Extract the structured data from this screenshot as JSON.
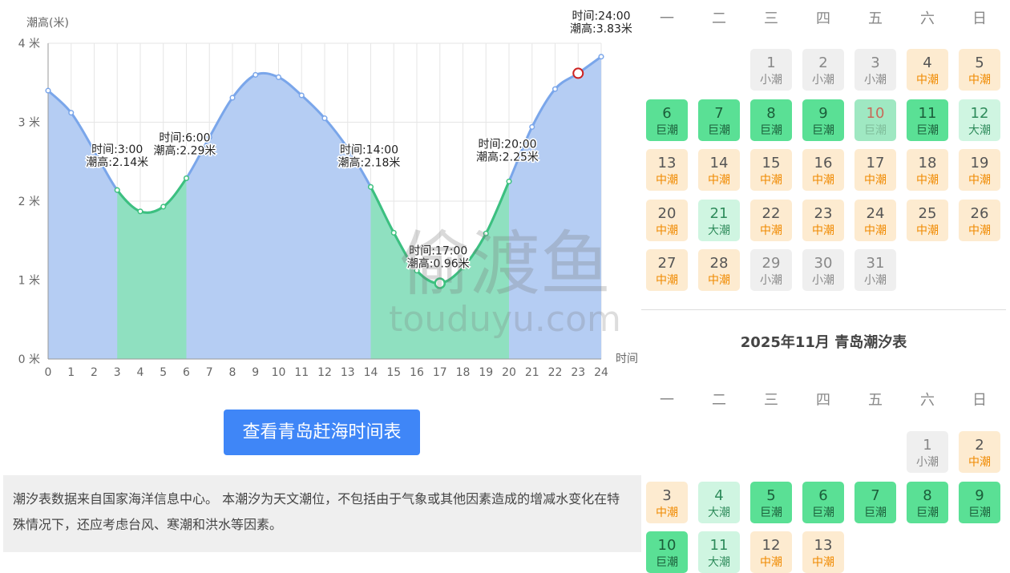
{
  "chart_data": {
    "type": "area",
    "ylabel": "潮高(米)",
    "xlabel": "时间",
    "y_ticks": [
      "0 米",
      "1 米",
      "2 米",
      "3 米",
      "4 米"
    ],
    "ylim": [
      0,
      4
    ],
    "xlim": [
      0,
      24
    ],
    "x": [
      0,
      1,
      2,
      3,
      4,
      5,
      6,
      7,
      8,
      9,
      10,
      11,
      12,
      13,
      14,
      15,
      16,
      17,
      18,
      19,
      20,
      21,
      22,
      23,
      24
    ],
    "values": [
      3.4,
      3.12,
      2.64,
      2.14,
      1.87,
      1.93,
      2.29,
      2.81,
      3.31,
      3.6,
      3.57,
      3.34,
      3.05,
      2.67,
      2.18,
      1.6,
      1.12,
      0.96,
      1.16,
      1.59,
      2.25,
      2.94,
      3.42,
      3.62,
      3.83
    ],
    "highlight_ranges": [
      [
        3,
        6
      ],
      [
        14,
        20
      ]
    ],
    "colors": {
      "area": "#b5cdf3",
      "line": "#7aa6ea",
      "highlight_area": "#8fe0c0",
      "highlight_line": "#3cc17e",
      "marker_red": "#cc2222"
    },
    "annotations": [
      {
        "x": 3,
        "line1": "时间:3:00",
        "line2": "潮高:2.14米"
      },
      {
        "x": 6,
        "line1": "时间:6:00",
        "line2": "潮高:2.29米"
      },
      {
        "x": 14,
        "line1": "时间:14:00",
        "line2": "潮高:2.18米"
      },
      {
        "x": 17,
        "line1": "时间:17:00",
        "line2": "潮高:0.96米"
      },
      {
        "x": 20,
        "line1": "时间:20:00",
        "line2": "潮高:2.25米"
      },
      {
        "x": 24,
        "line1": "时间:24:00",
        "line2": "潮高:3.83米"
      }
    ],
    "current_marker_x": 23,
    "low_marker_x": 17,
    "watermark": {
      "main": "偷渡鱼",
      "sub": "touduyu.com"
    }
  },
  "button_label": "查看青岛赶海时间表",
  "notice_text": "潮汐表数据来自国家海洋信息中心。 本潮汐为天文潮位，不包括由于气象或其他因素造成的增减水变化在特殊情况下，还应考虑台风、寒潮和洪水等因素。",
  "weekdays": [
    "一",
    "二",
    "三",
    "四",
    "五",
    "六",
    "日"
  ],
  "calendar_oct": {
    "start_col": 2,
    "days": [
      {
        "d": "1",
        "t": "小潮"
      },
      {
        "d": "2",
        "t": "小潮"
      },
      {
        "d": "3",
        "t": "小潮"
      },
      {
        "d": "4",
        "t": "中潮"
      },
      {
        "d": "5",
        "t": "中潮"
      },
      {
        "d": "6",
        "t": "巨潮"
      },
      {
        "d": "7",
        "t": "巨潮"
      },
      {
        "d": "8",
        "t": "巨潮"
      },
      {
        "d": "9",
        "t": "巨潮"
      },
      {
        "d": "10",
        "t": "巨潮",
        "today": true
      },
      {
        "d": "11",
        "t": "巨潮"
      },
      {
        "d": "12",
        "t": "大潮"
      },
      {
        "d": "13",
        "t": "中潮"
      },
      {
        "d": "14",
        "t": "中潮"
      },
      {
        "d": "15",
        "t": "中潮"
      },
      {
        "d": "16",
        "t": "中潮"
      },
      {
        "d": "17",
        "t": "中潮"
      },
      {
        "d": "18",
        "t": "中潮"
      },
      {
        "d": "19",
        "t": "中潮"
      },
      {
        "d": "20",
        "t": "中潮"
      },
      {
        "d": "21",
        "t": "大潮"
      },
      {
        "d": "22",
        "t": "中潮"
      },
      {
        "d": "23",
        "t": "中潮"
      },
      {
        "d": "24",
        "t": "中潮"
      },
      {
        "d": "25",
        "t": "中潮"
      },
      {
        "d": "26",
        "t": "中潮"
      },
      {
        "d": "27",
        "t": "中潮"
      },
      {
        "d": "28",
        "t": "中潮"
      },
      {
        "d": "29",
        "t": "小潮"
      },
      {
        "d": "30",
        "t": "小潮"
      },
      {
        "d": "31",
        "t": "小潮"
      }
    ]
  },
  "calendar_nov": {
    "title": "2025年11月 青岛潮汐表",
    "start_col": 5,
    "days": [
      {
        "d": "1",
        "t": "小潮"
      },
      {
        "d": "2",
        "t": "中潮"
      },
      {
        "d": "3",
        "t": "中潮"
      },
      {
        "d": "4",
        "t": "大潮"
      },
      {
        "d": "5",
        "t": "巨潮"
      },
      {
        "d": "6",
        "t": "巨潮"
      },
      {
        "d": "7",
        "t": "巨潮"
      },
      {
        "d": "8",
        "t": "巨潮"
      },
      {
        "d": "9",
        "t": "巨潮"
      },
      {
        "d": "10",
        "t": "巨潮"
      },
      {
        "d": "11",
        "t": "大潮"
      },
      {
        "d": "12",
        "t": "中潮"
      },
      {
        "d": "13",
        "t": "中潮"
      }
    ]
  }
}
